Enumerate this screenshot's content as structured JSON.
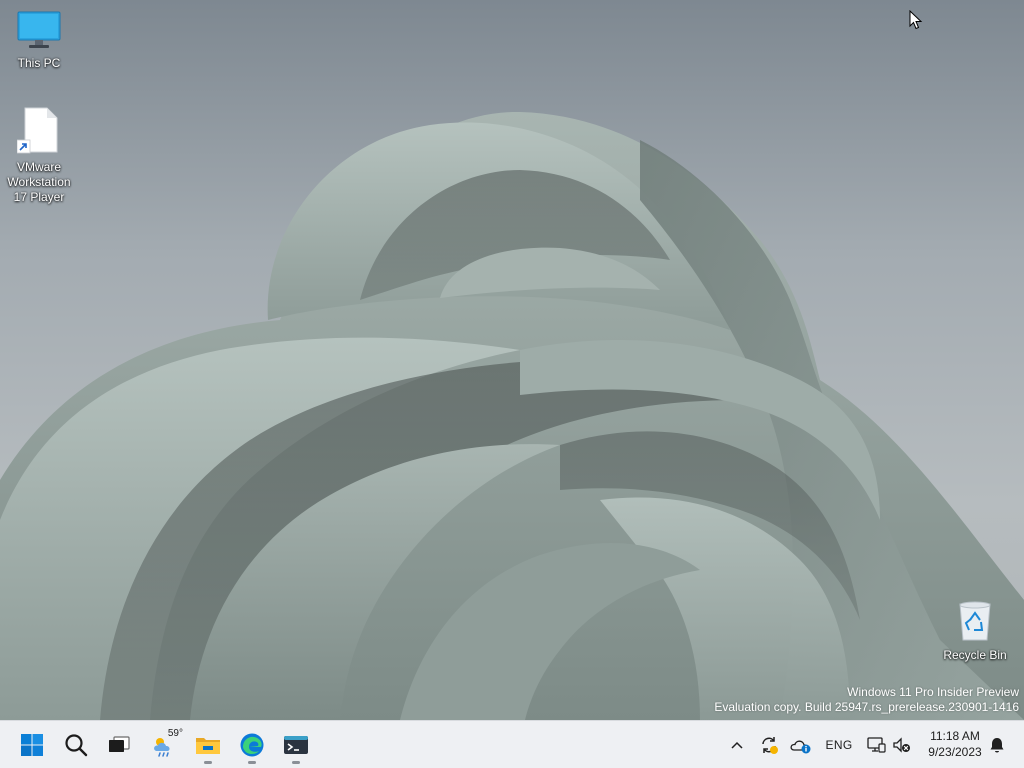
{
  "desktop": {
    "icons": [
      {
        "label": "This PC",
        "icon": "this-pc-icon"
      },
      {
        "label": "VMware Workstation 17 Player",
        "icon": "file-shortcut-icon"
      },
      {
        "label": "Recycle Bin",
        "icon": "recycle-bin-icon"
      }
    ],
    "watermark": {
      "line1": "Windows 11 Pro Insider Preview",
      "line2": "Evaluation copy. Build 25947.rs_prerelease.230901-1416"
    }
  },
  "taskbar": {
    "weather_temp": "59°",
    "language": "ENG",
    "time": "11:18 AM",
    "date": "9/23/2023",
    "apps": [
      "start-icon",
      "search-icon",
      "task-view-icon",
      "widgets-weather-icon",
      "file-explorer-icon",
      "edge-icon",
      "terminal-icon"
    ]
  },
  "colors": {
    "taskbar_bg": "#eef0f3",
    "start_blue": "#0078d4",
    "wallpaper_sage": "#8c9c97"
  }
}
